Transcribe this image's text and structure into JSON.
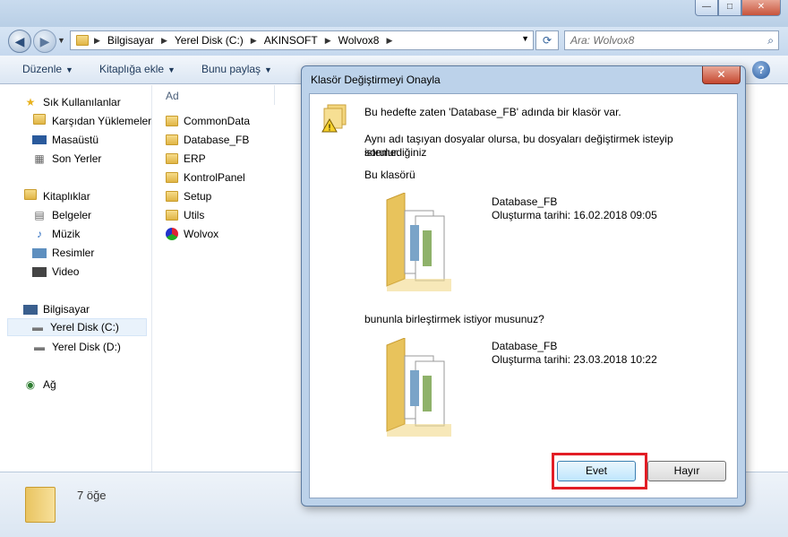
{
  "window": {
    "controls": {
      "minimize": "—",
      "maximize": "□",
      "close": "✕"
    }
  },
  "address": {
    "breadcrumbs": [
      "Bilgisayar",
      "Yerel Disk (C:)",
      "AKINSOFT",
      "Wolvox8"
    ],
    "search_placeholder": "Ara: Wolvox8"
  },
  "toolbar": {
    "items": [
      "Düzenle",
      "Kitaplığa ekle",
      "Bunu paylaş"
    ]
  },
  "navpane": {
    "favorites_header": "Sık Kullanılanlar",
    "favorites": [
      "Karşıdan Yüklemeler",
      "Masaüstü",
      "Son Yerler"
    ],
    "libraries_header": "Kitaplıklar",
    "libraries": [
      "Belgeler",
      "Müzik",
      "Resimler",
      "Video"
    ],
    "computer_header": "Bilgisayar",
    "drives": [
      "Yerel Disk (C:)",
      "Yerel Disk (D:)"
    ],
    "network": "Ağ"
  },
  "files": {
    "column_header": "Ad",
    "items": [
      "CommonData",
      "Database_FB",
      "ERP",
      "KontrolPanel",
      "Setup",
      "Utils",
      "Wolvox"
    ]
  },
  "status": {
    "count_text": "7 öğe"
  },
  "dialog": {
    "title": "Klasör Değiştirmeyi Onayla",
    "line1": "Bu hedefte zaten 'Database_FB' adında bir klasör var.",
    "line2a": "Aynı adı taşıyan dosyalar olursa, bu dosyaları değiştirmek isteyip istemediğiniz",
    "line2b": "sorulur.",
    "this_folder_label": "Bu klasörü",
    "existing": {
      "name": "Database_FB",
      "created": "Oluşturma tarihi: 16.02.2018 09:05"
    },
    "merge_question": "bununla birleştirmek istiyor musunuz?",
    "incoming": {
      "name": "Database_FB",
      "created": "Oluşturma tarihi: 23.03.2018 10:22"
    },
    "yes_label": "Evet",
    "no_label": "Hayır",
    "close": "✕"
  },
  "colors": {
    "highlight": "#e21d25"
  }
}
